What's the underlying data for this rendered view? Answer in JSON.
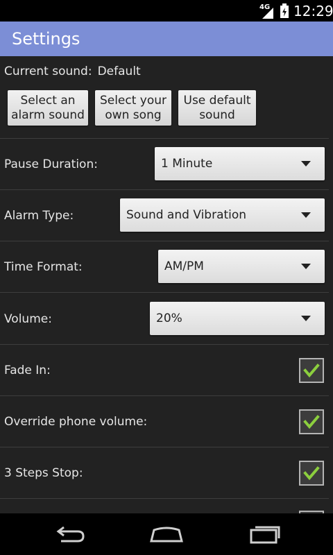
{
  "status_bar": {
    "network": "4G",
    "time": "12:29"
  },
  "action_bar": {
    "title": "Settings"
  },
  "current_sound": {
    "label": "Current sound:",
    "value": "Default"
  },
  "sound_buttons": [
    {
      "label": "Select an\nalarm sound"
    },
    {
      "label": "Select your\nown song"
    },
    {
      "label": "Use default\nsound"
    }
  ],
  "settings": {
    "pause_duration": {
      "label": "Pause Duration:",
      "value": "1 Minute"
    },
    "alarm_type": {
      "label": "Alarm Type:",
      "value": "Sound and Vibration"
    },
    "time_format": {
      "label": "Time Format:",
      "value": "AM/PM"
    },
    "volume": {
      "label": "Volume:",
      "value": "20%"
    },
    "fade_in": {
      "label": "Fade In:",
      "checked": true
    },
    "override_volume": {
      "label": "Override phone volume:",
      "checked": true
    },
    "three_steps_stop": {
      "label": "3 Steps Stop:",
      "checked": true
    }
  },
  "nav_bar": {
    "back_icon": "back-icon",
    "home_icon": "home-icon",
    "recents_icon": "recents-icon"
  },
  "colors": {
    "action_bar": "#7c8ed6",
    "background": "#222222",
    "check_accent": "#8ccf3e"
  }
}
